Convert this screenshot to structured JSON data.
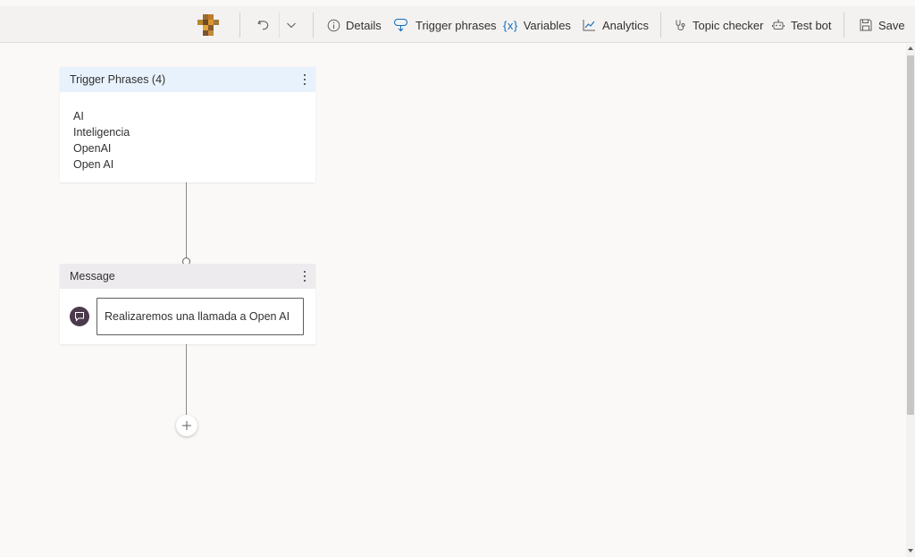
{
  "toolbar": {
    "details": "Details",
    "trigger_phrases": "Trigger phrases",
    "variables": "Variables",
    "analytics": "Analytics",
    "topic_checker": "Topic checker",
    "test_bot": "Test bot",
    "save": "Save"
  },
  "trigger_card": {
    "title": "Trigger Phrases (4)",
    "phrases": [
      "AI",
      "Inteligencia",
      "OpenAI",
      "Open AI"
    ]
  },
  "message_card": {
    "title": "Message",
    "text": "Realizaremos una llamada a Open AI"
  },
  "colors": {
    "trigger_header_bg": "#e8f2fc",
    "message_header_bg": "#edebee",
    "message_icon_bg": "#4b3a4c",
    "canvas_bg": "#faf9f8"
  }
}
